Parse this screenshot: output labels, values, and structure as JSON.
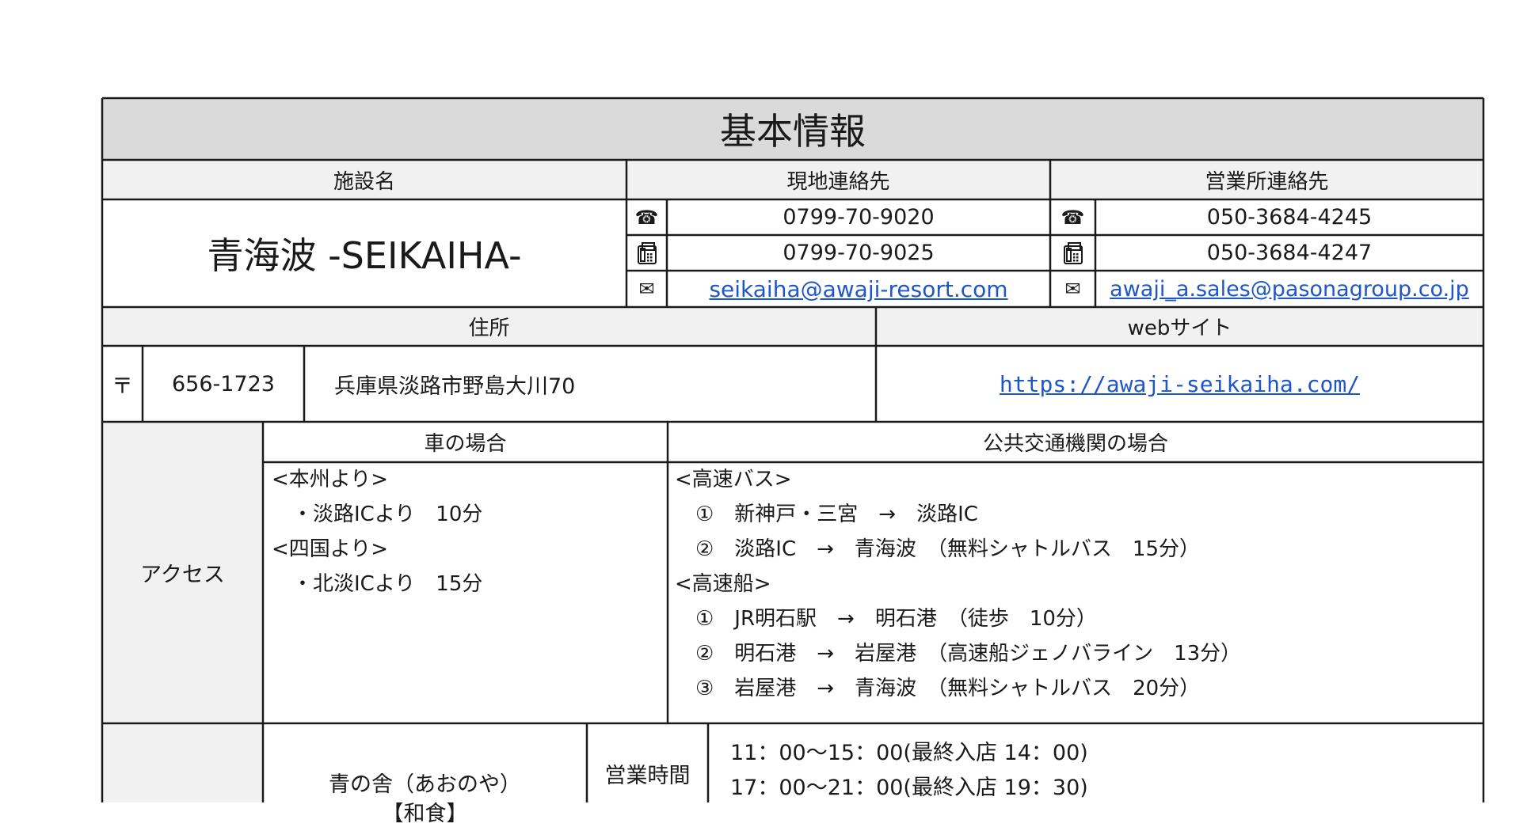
{
  "title": "基本情報",
  "headers": {
    "facility_name": "施設名",
    "local_contact": "現地連絡先",
    "sales_contact": "営業所連絡先",
    "address": "住所",
    "website": "webサイト",
    "by_car": "車の場合",
    "by_public_transport": "公共交通機関の場合",
    "access": "アクセス",
    "business_hours": "営業時間"
  },
  "facility_name": "青海波 -SEIKAIHA-",
  "local_contact": {
    "tel": "0799-70-9020",
    "fax": "0799-70-9025",
    "email": "seikaiha@awaji-resort.com"
  },
  "sales_contact": {
    "tel": "050-3684-4245",
    "fax": "050-3684-4247",
    "email": "awaji_a.sales@pasonagroup.co.jp"
  },
  "icons": {
    "phone": "☎",
    "fax": "📠",
    "mail": "✉",
    "postal": "〒"
  },
  "address": {
    "postal_code": "656-1723",
    "line": "兵庫県淡路市野島大川70"
  },
  "website_url": "https://awaji-seikaiha.com/",
  "access_car": [
    "<本州より>",
    "　・淡路ICより　10分",
    "<四国より>",
    "　・北淡ICより　15分"
  ],
  "access_public": [
    "<高速バス>",
    "　①　新神戸・三宮　→　淡路IC",
    "　②　淡路IC　→　青海波　（無料シャトルバス　15分）",
    "<高速船>",
    "　①　JR明石駅　→　明石港　（徒歩　10分）",
    "　②　明石港　→　岩屋港　（高速船ジェノバライン　13分）",
    "　③　岩屋港　→　青海波　（無料シャトルバス　20分）"
  ],
  "restaurant": {
    "name": "青の舎（あおのや）",
    "cuisine": "【和食】",
    "hours": [
      "11：00〜15：00(最終入店 14：00)",
      "17：00〜21：00(最終入店 19：30)"
    ]
  },
  "colors": {
    "title_bg": "#dadada",
    "header_bg": "#f1f1f1",
    "link": "#1e56c9",
    "border": "#1a1a1a"
  }
}
